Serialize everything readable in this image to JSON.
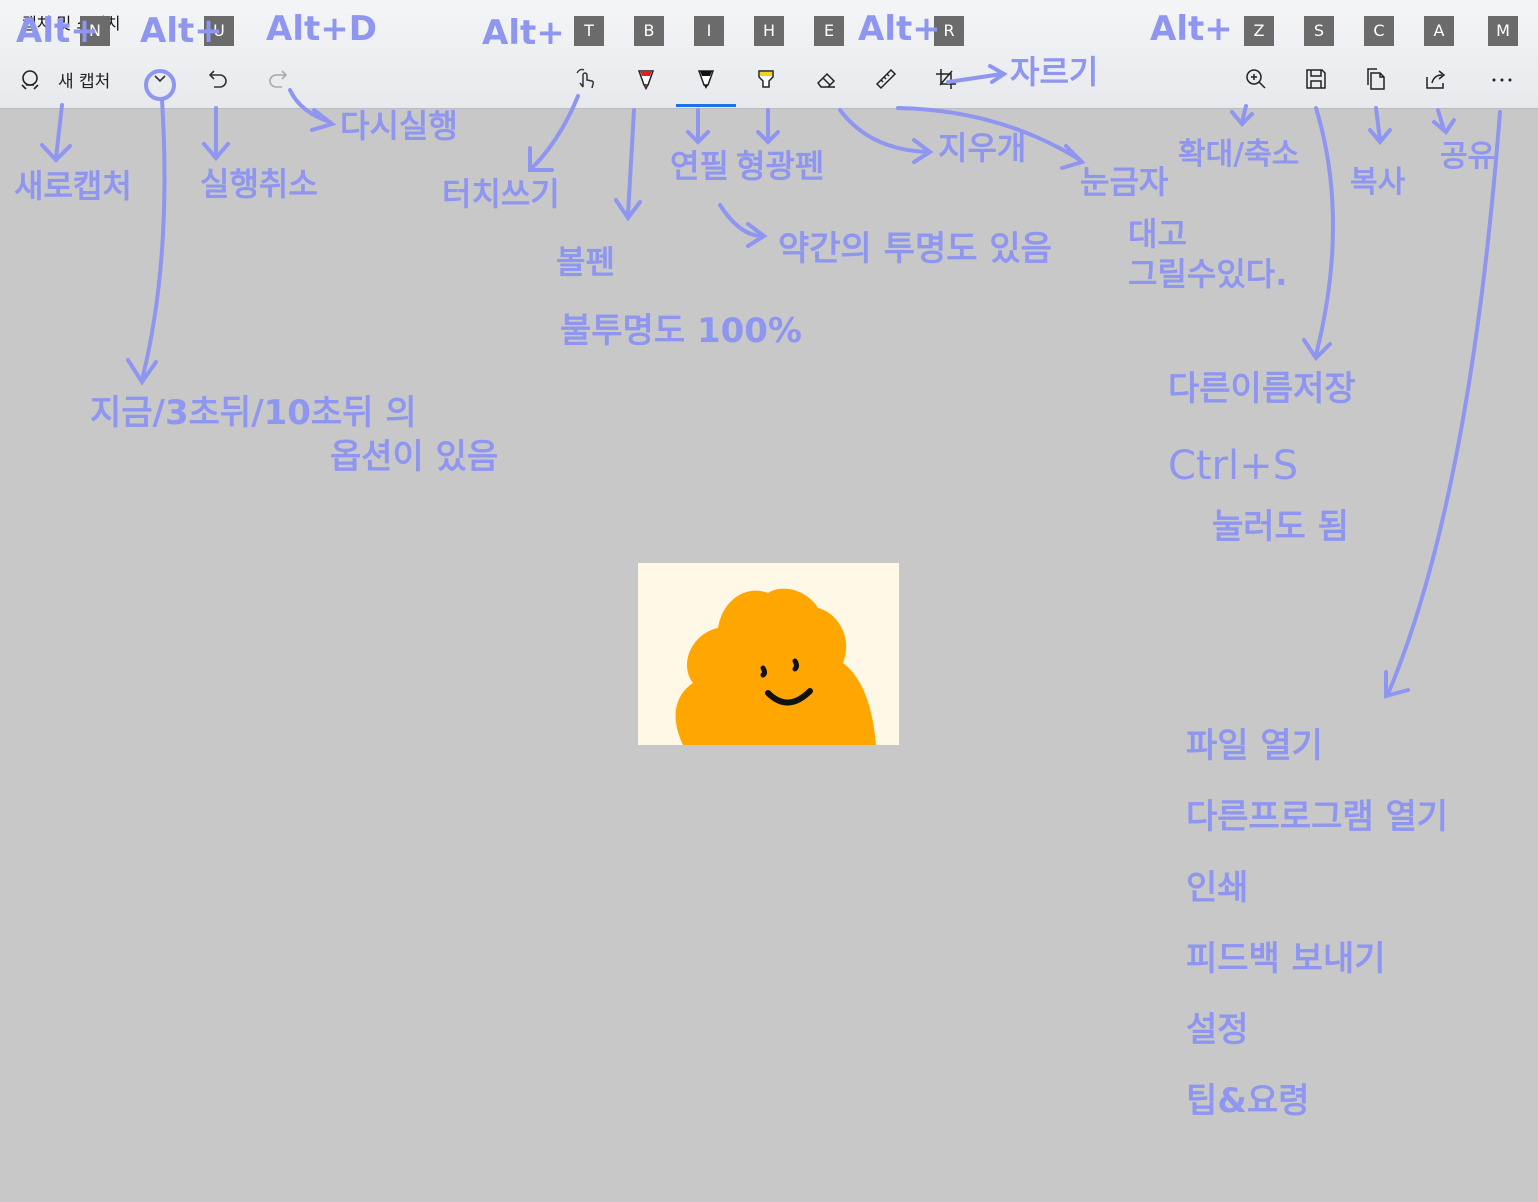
{
  "window": {
    "title": "캡처 및 스케치"
  },
  "toolbar": {
    "new_capture_label": "새 캡처",
    "keytips": [
      "N",
      "U",
      "T",
      "B",
      "I",
      "H",
      "E",
      "R",
      "Z",
      "S",
      "C",
      "A",
      "M"
    ],
    "icons": {
      "new_capture": "new-capture-icon",
      "mode_dropdown": "chevron-down-icon",
      "undo": "undo-icon",
      "redo": "redo-icon",
      "touch_write": "touch-writing-icon",
      "ballpoint_pen": "ballpoint-pen-icon",
      "pencil": "pencil-icon",
      "highlighter": "highlighter-icon",
      "eraser": "eraser-icon",
      "ruler": "ruler-icon",
      "crop": "crop-icon",
      "zoom": "zoom-icon",
      "save": "save-icon",
      "copy": "copy-icon",
      "share": "share-icon",
      "more": "more-icon"
    },
    "colors": {
      "ballpoint_pen": "#e02020",
      "pencil": "#111111",
      "highlighter": "#f2d21b",
      "active_underline": "#1a73e8"
    }
  },
  "annotations": {
    "alt_n": "Alt+",
    "alt_u": "Alt+",
    "alt_d": "Alt+D",
    "alt_tbihe": "Alt+",
    "alt_r": "Alt+",
    "alt_zscam": "Alt+",
    "new_capture": "새로캡처",
    "undo": "실행취소",
    "redo": "다시실행",
    "delay": "지금/3초뒤/10초뒤 의",
    "delay2": "옵션이 있음",
    "touch": "터치쓰기",
    "ballpoint": "볼펜",
    "ballpoint_opacity": "불투명도 100%",
    "pencil": "연필",
    "highlighter": "형광펜",
    "transparency": "약간의 투명도 있음",
    "eraser": "지우개",
    "ruler": "눈금자",
    "ruler_desc1": "대고",
    "ruler_desc2": "그릴수있다.",
    "crop": "자르기",
    "zoom": "확대/축소",
    "save_as": "다른이름저장",
    "ctrl_s": "Ctrl+S",
    "ctrl_s_desc": "눌러도 됨",
    "copy": "복사",
    "share": "공유",
    "more_items": [
      "파일 열기",
      "다른프로그램 열기",
      "인쇄",
      "피드백 보내기",
      "설정",
      "팁&요령"
    ]
  },
  "canvas": {
    "image_bg": "#fff8e6",
    "blob_color": "#ffa600"
  }
}
